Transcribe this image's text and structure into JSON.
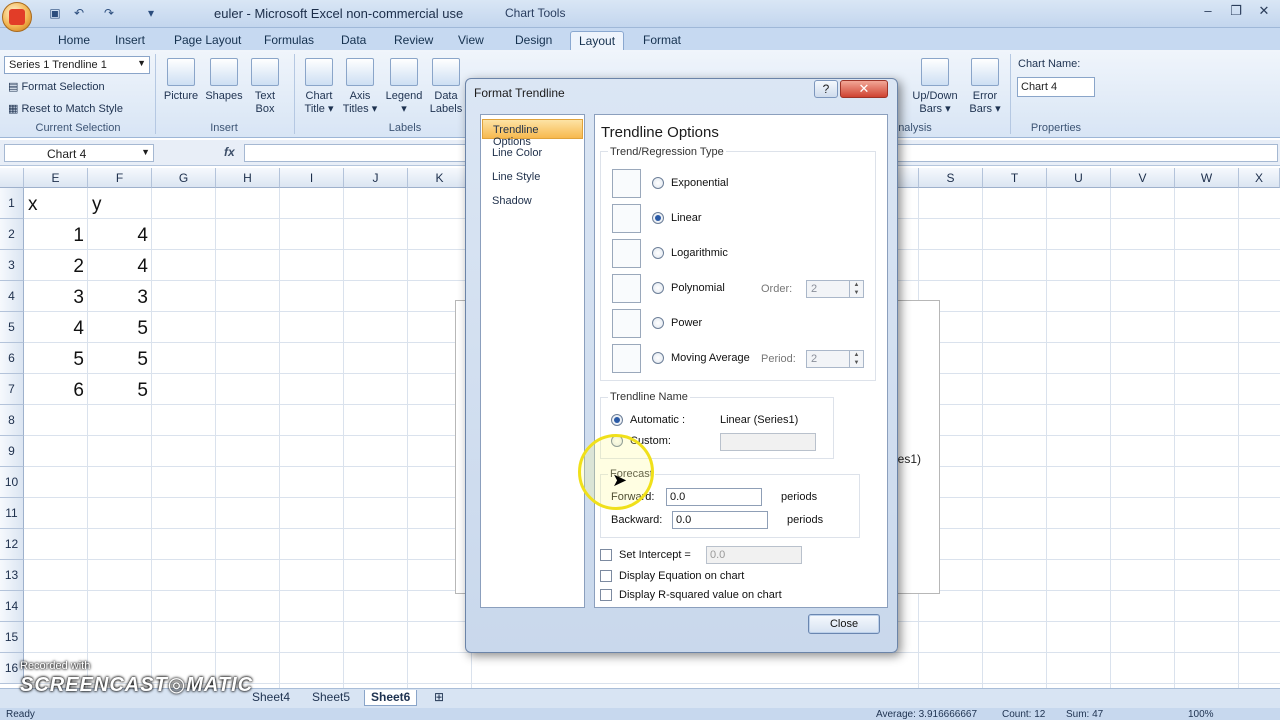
{
  "titlebar": {
    "app_title": "euler - Microsoft Excel non-commercial use",
    "context_label": "Chart Tools",
    "minimize": "–",
    "restore": "❐",
    "close": "✕",
    "colors": {
      "accent": "#c6d9f1",
      "context": "#e8cf8f"
    }
  },
  "tabs": [
    {
      "label": "Home"
    },
    {
      "label": "Insert"
    },
    {
      "label": "Page Layout"
    },
    {
      "label": "Formulas"
    },
    {
      "label": "Data"
    },
    {
      "label": "Review"
    },
    {
      "label": "View"
    },
    {
      "label": "Design"
    },
    {
      "label": "Layout"
    },
    {
      "label": "Format"
    }
  ],
  "ribbon": {
    "current_selection": {
      "selected": "Series 1 Trendline 1",
      "format_selection": "Format Selection",
      "reset": "Reset to Match Style",
      "group": "Current Selection"
    },
    "insert": {
      "picture": "Picture",
      "shapes": "Shapes",
      "text_box_1": "Text",
      "text_box_2": "Box",
      "group": "Insert"
    },
    "labels": {
      "chart_title": [
        "Chart",
        "Title ▾"
      ],
      "axis_titles": [
        "Axis",
        "Titles ▾"
      ],
      "legend": "Legend ▾",
      "data_labels": [
        "Data",
        "Labels"
      ],
      "group": "Labels"
    },
    "analysis": {
      "updown": [
        "Up/Down",
        "Bars ▾"
      ],
      "error": [
        "Error",
        "Bars ▾"
      ],
      "group": "nalysis"
    },
    "properties": {
      "chart_name_label": "Chart Name:",
      "chart_name": "Chart 4",
      "group": "Properties"
    }
  },
  "formula_bar": {
    "name_box": "Chart 4",
    "fx": "fx",
    "value": ""
  },
  "grid": {
    "columns": [
      "E",
      "F",
      "G",
      "H",
      "I",
      "J",
      "K",
      "S",
      "T",
      "U",
      "V",
      "W",
      "X"
    ],
    "rows": [
      "1",
      "2",
      "3",
      "4",
      "5",
      "6",
      "7",
      "8",
      "9",
      "10",
      "11",
      "12",
      "13",
      "14",
      "15",
      "16"
    ],
    "header_x": "x",
    "header_y": "y",
    "x_values": [
      "1",
      "2",
      "3",
      "4",
      "5",
      "6"
    ],
    "y_values": [
      "4",
      "4",
      "3",
      "5",
      "5",
      "5"
    ]
  },
  "chart_peek": {
    "legend_fragment": "ies1)"
  },
  "sheets": {
    "tabs": [
      "Sheet4",
      "Sheet5",
      "Sheet6"
    ],
    "active": "Sheet6"
  },
  "status": {
    "ready": "Ready",
    "average": "Average: 3.916666667",
    "count": "Count: 12",
    "sum": "Sum: 47",
    "zoom": "100%"
  },
  "watermark": {
    "line1": "Recorded with",
    "line2": "SCREENCAST◎MATIC"
  },
  "dialog": {
    "title": "Format Trendline",
    "help": "?",
    "close_x": "✕",
    "nav": [
      {
        "label": "Trendline Options",
        "selected": true
      },
      {
        "label": "Line Color",
        "selected": false
      },
      {
        "label": "Line Style",
        "selected": false
      },
      {
        "label": "Shadow",
        "selected": false
      }
    ],
    "content_title": "Trendline Options",
    "trend_type_label": "Trend/Regression Type",
    "types": [
      {
        "label": "Exponential",
        "selected": false
      },
      {
        "label": "Linear",
        "selected": true
      },
      {
        "label": "Logarithmic",
        "selected": false
      },
      {
        "label": "Polynomial",
        "selected": false
      },
      {
        "label": "Power",
        "selected": false
      },
      {
        "label": "Moving Average",
        "selected": false
      }
    ],
    "order_label": "Order:",
    "order_value": "2",
    "period_label": "Period:",
    "period_value": "2",
    "name_section": "Trendline Name",
    "automatic_label": "Automatic :",
    "automatic_value": "Linear (Series1)",
    "custom_label": "Custom:",
    "custom_value": "",
    "forecast_label": "Forecast",
    "forward_label": "Forward:",
    "forward_value": "0.0",
    "backward_label": "Backward:",
    "backward_value": "0.0",
    "periods": "periods",
    "set_intercept_label": "Set Intercept =",
    "intercept_value": "0.0",
    "display_equation": "Display Equation on chart",
    "display_r2": "Display R-squared value on chart",
    "close_button": "Close"
  }
}
